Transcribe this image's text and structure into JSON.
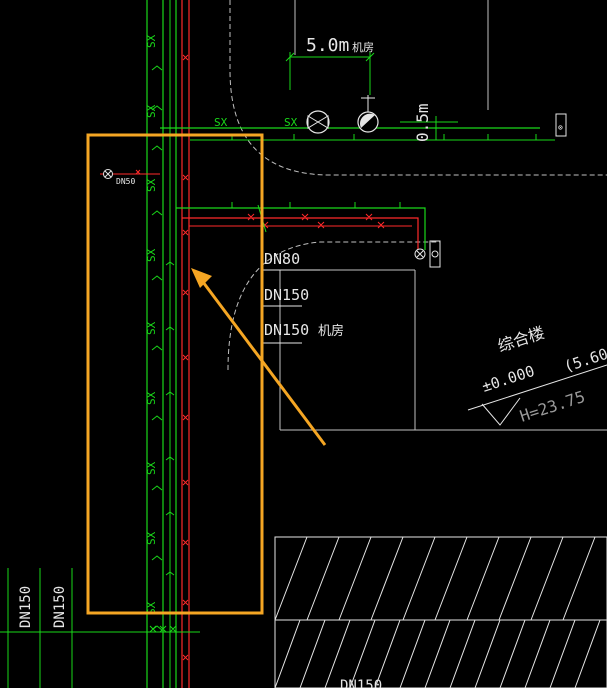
{
  "labels": {
    "dim_5m": "5.0m",
    "jifang_top": "机房",
    "dim_05m": "0.5m",
    "sx": "SX",
    "dn50": "DN50",
    "dn80": "DN80",
    "dn150": "DN150",
    "jifang_mid": "机房",
    "building_name": "综合楼",
    "elev_zero": "±0.000",
    "elev_paren": "(5.60",
    "height": "H=23.75"
  },
  "colors": {
    "background": "#000000",
    "green_pipe": "#19d819",
    "red_pipe": "#ff2a2a",
    "white_line": "#dcdcdc",
    "highlight": "#f5a623"
  }
}
